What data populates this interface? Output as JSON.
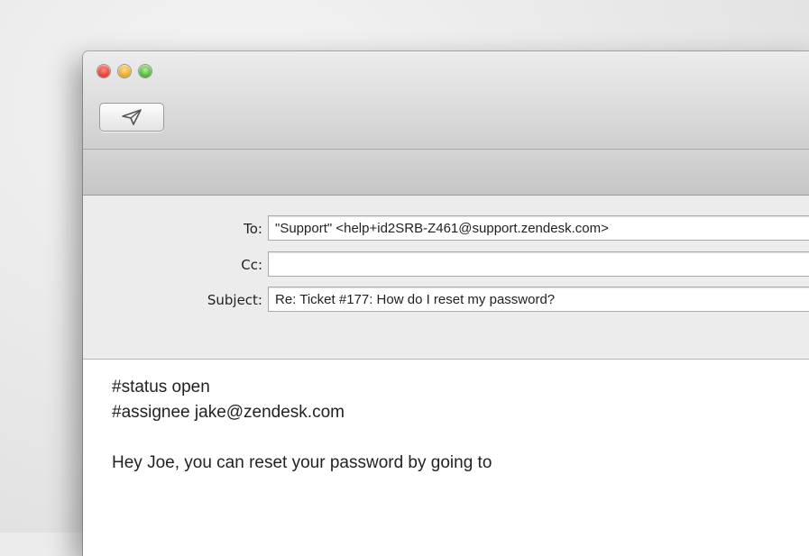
{
  "window": {
    "controls": [
      "close",
      "minimize",
      "zoom"
    ]
  },
  "toolbar": {
    "send_icon": "paper-plane-icon"
  },
  "header": {
    "to_label": "To:",
    "to_value": "\"Support\" <help+id2SRB-Z461@support.zendesk.com>",
    "cc_label": "Cc:",
    "cc_value": "",
    "subject_label": "Subject:",
    "subject_value": "Re: Ticket #177: How do I reset my password?"
  },
  "body": {
    "lines": [
      "#status open",
      "#assignee jake@zendesk.com",
      "",
      "Hey Joe, you can reset your password by going to"
    ]
  }
}
